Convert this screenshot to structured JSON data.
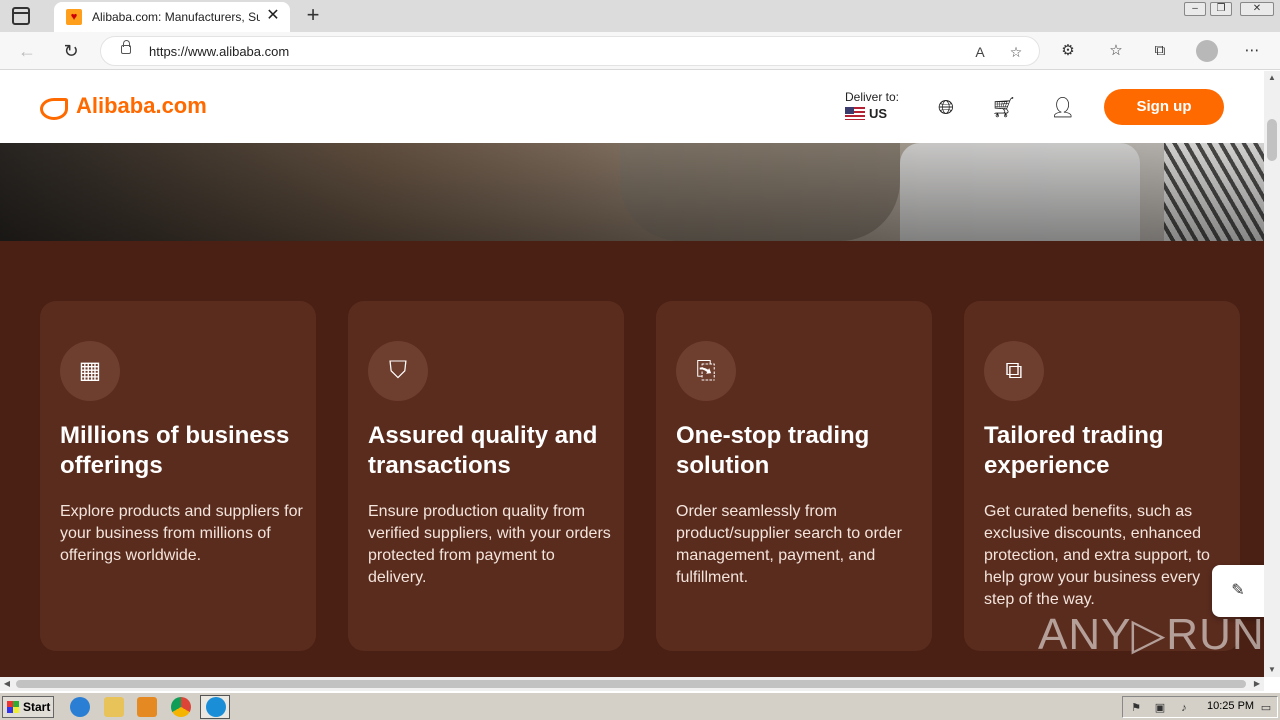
{
  "browser": {
    "tab_title": "Alibaba.com: Manufacturers, Suppliers, Exporters & Importers",
    "tab_close": "✕",
    "new_tab": "+",
    "url": "https://www.alibaba.com"
  },
  "header": {
    "logo_text": "Alibaba.com",
    "deliver_label": "Deliver to:",
    "deliver_country": "US",
    "signup_label": "Sign up"
  },
  "features": [
    {
      "title": "Millions of business offerings",
      "description": "Explore products and suppliers for your business from millions of offerings worldwide.",
      "icon": "grid-icon"
    },
    {
      "title": "Assured quality and transactions",
      "description": "Ensure production quality from verified suppliers, with your orders protected from payment to delivery.",
      "icon": "shield-check-icon"
    },
    {
      "title": "One-stop trading solution",
      "description": "Order seamlessly from product/supplier search to order management, payment, and fulfillment.",
      "icon": "order-icon"
    },
    {
      "title": "Tailored trading experience",
      "description": "Get curated benefits, such as exclusive discounts, enhanced protection, and extra support, to help grow your business every step of the way.",
      "icon": "layers-icon"
    }
  ],
  "watermark": "ANY▷RUN",
  "taskbar": {
    "start_label": "Start",
    "clock": "10:25 PM"
  },
  "colors": {
    "brand": "#ff6a00",
    "feature_bg": "#4a2014",
    "card_bg": "#5a2c1e"
  }
}
